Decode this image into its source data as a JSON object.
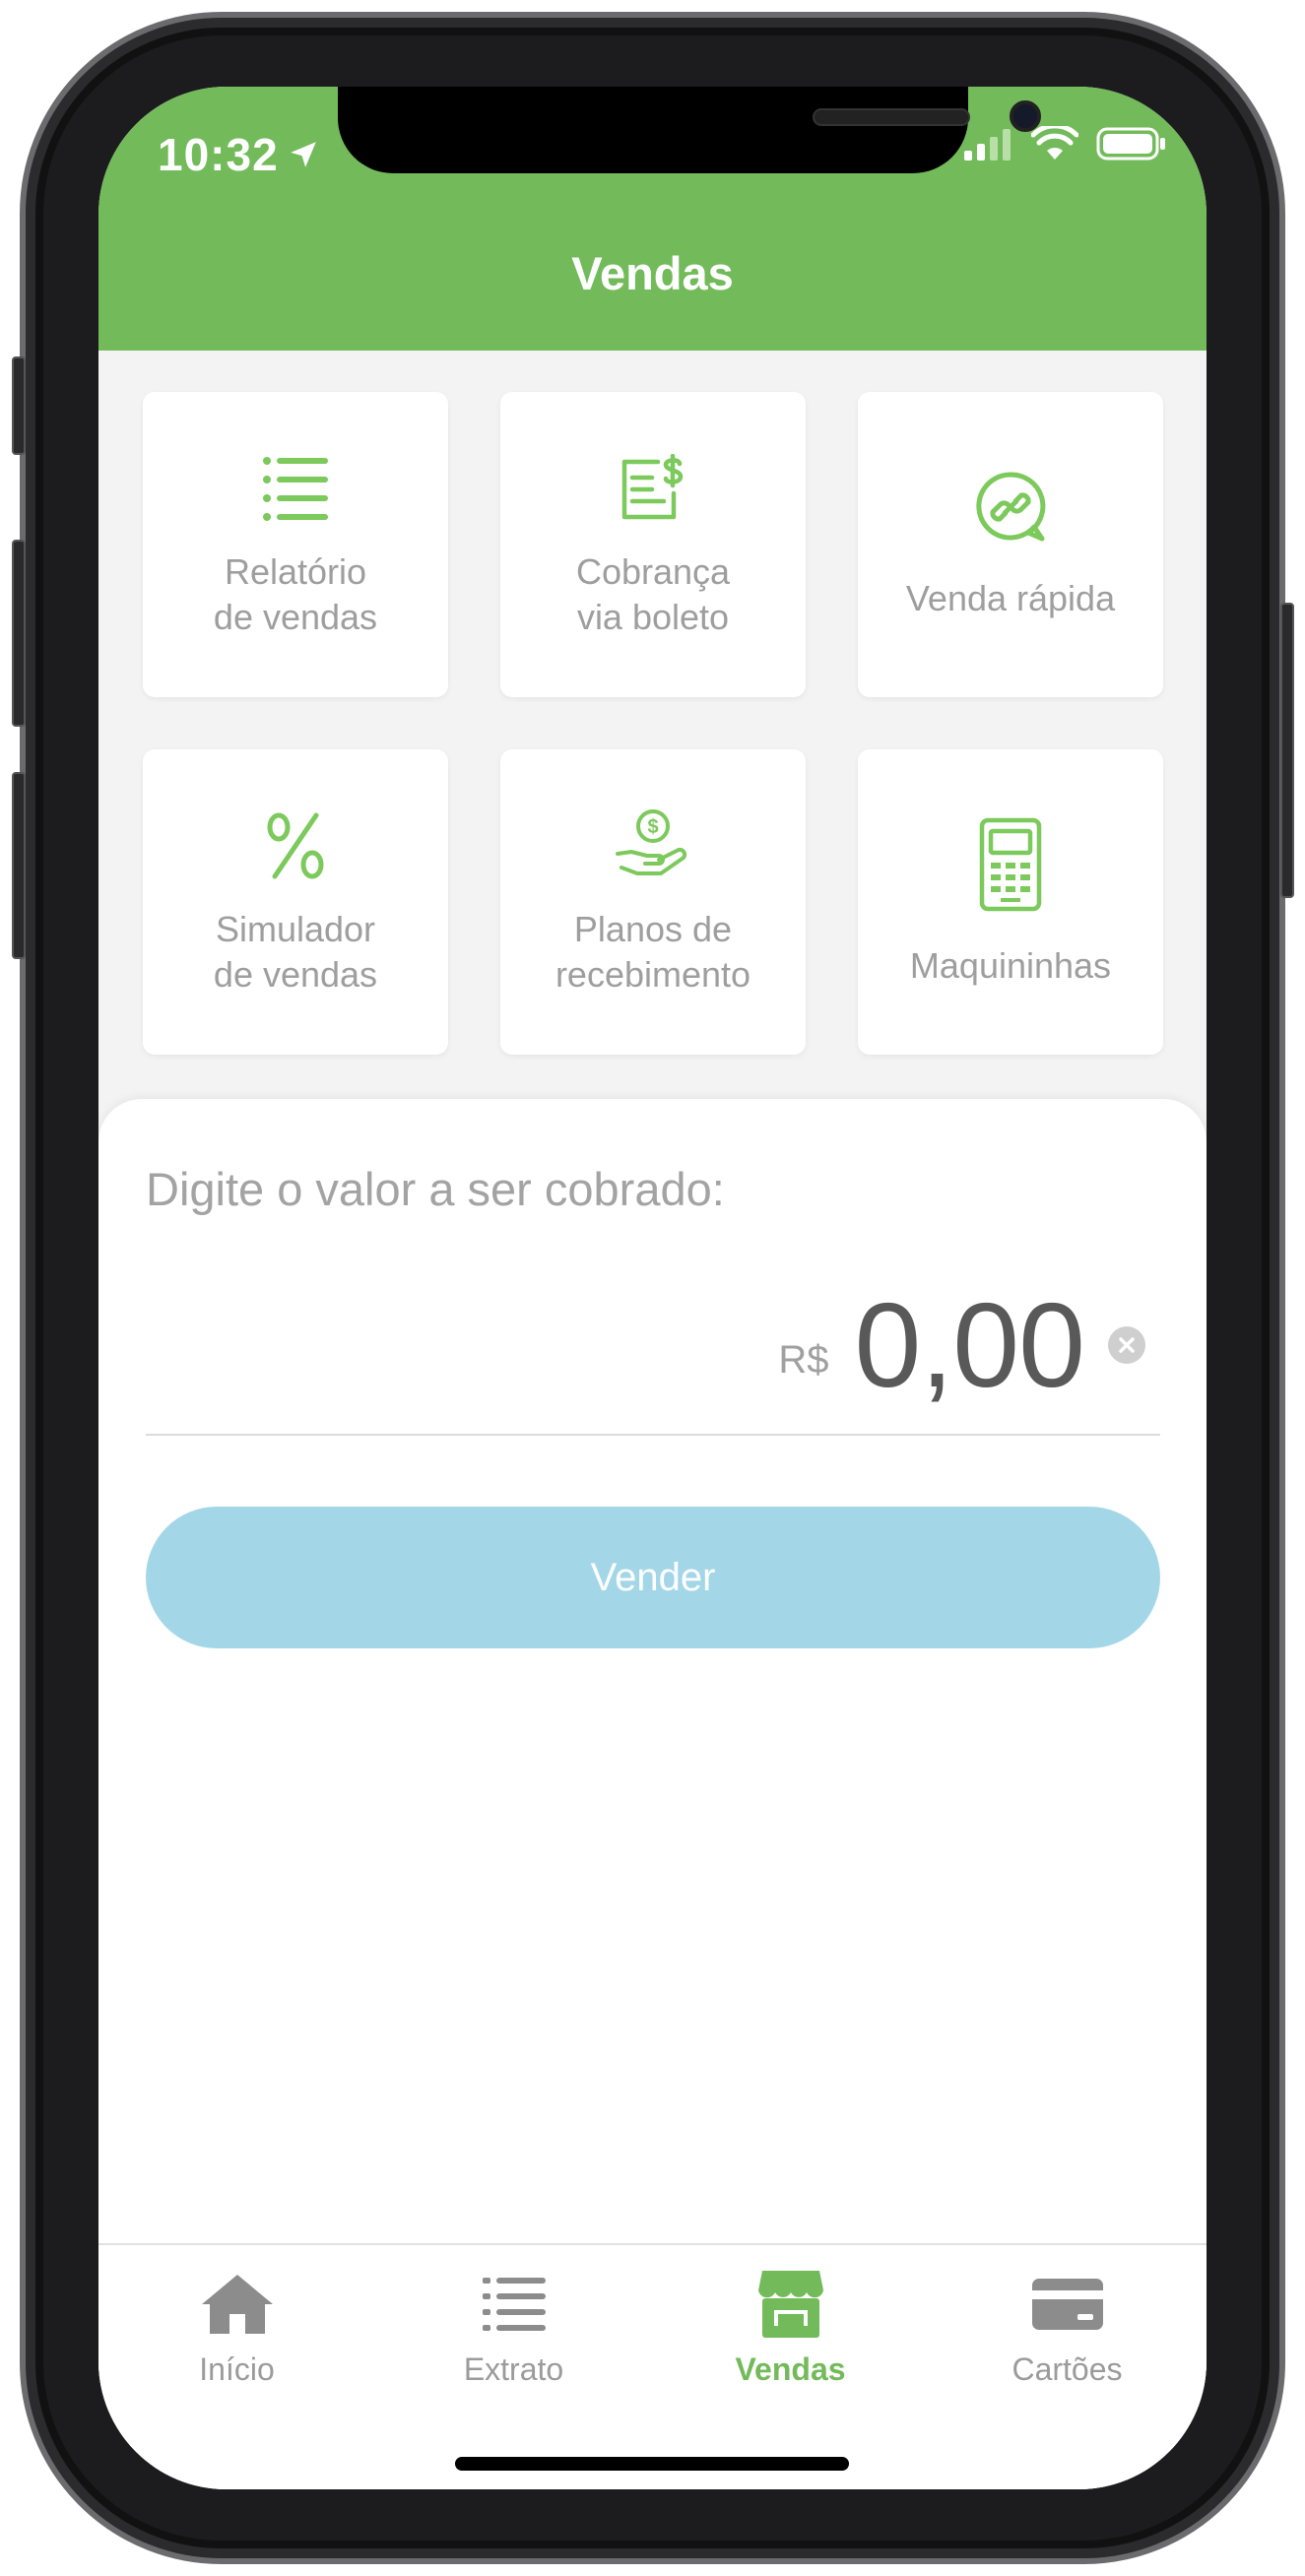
{
  "status_bar": {
    "time": "10:32"
  },
  "header": {
    "title": "Vendas"
  },
  "tiles": [
    {
      "label": "Relatório\nde vendas",
      "icon": "list-icon"
    },
    {
      "label": "Cobrança\nvia boleto",
      "icon": "invoice-icon"
    },
    {
      "label": "Venda rápida",
      "icon": "link-chat-icon"
    },
    {
      "label": "Simulador\nde vendas",
      "icon": "percent-icon"
    },
    {
      "label": "Planos de\nrecebimento",
      "icon": "hand-coin-icon"
    },
    {
      "label": "Maquininhas",
      "icon": "card-machine-icon"
    }
  ],
  "charge": {
    "prompt": "Digite o valor a ser cobrado:",
    "currency": "R$",
    "value": "0,00",
    "sell_label": "Vender"
  },
  "tabbar": {
    "items": [
      {
        "label": "Início",
        "icon": "home-icon",
        "active": false
      },
      {
        "label": "Extrato",
        "icon": "list-icon",
        "active": false
      },
      {
        "label": "Vendas",
        "icon": "store-icon",
        "active": true
      },
      {
        "label": "Cartões",
        "icon": "card-icon",
        "active": false
      }
    ]
  },
  "colors": {
    "brand_green": "#73bb5a",
    "button_blue": "#a3d7e8",
    "muted_text": "#9e9e9e"
  }
}
